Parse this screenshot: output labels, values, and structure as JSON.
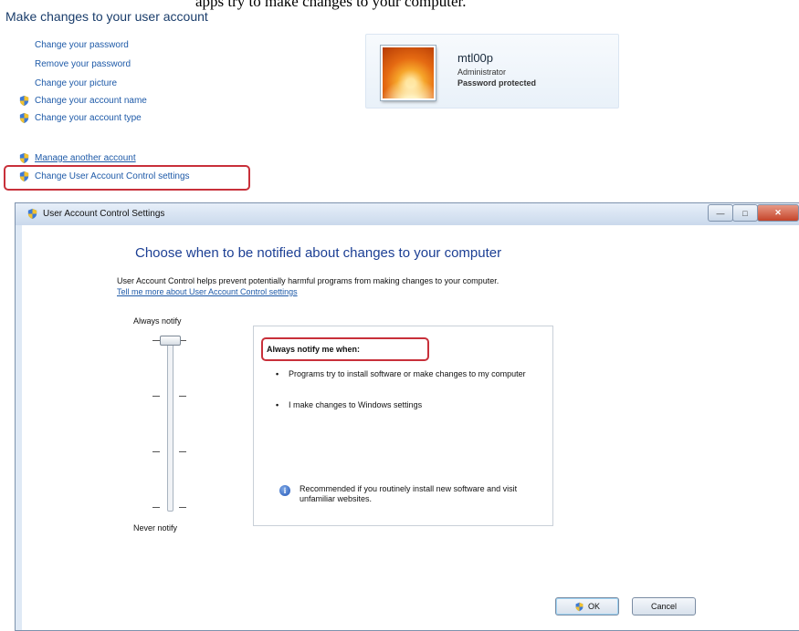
{
  "caption": "apps try to make changes to your computer.",
  "panel_section": {
    "title": "Make changes to your user account",
    "links": [
      {
        "label": "Change your password",
        "shield": false
      },
      {
        "label": "Remove your password",
        "shield": false
      },
      {
        "label": "Change your picture",
        "shield": false
      },
      {
        "label": "Change your account name",
        "shield": true
      },
      {
        "label": "Change your account type",
        "shield": true
      }
    ],
    "other_links": [
      {
        "label": "Manage another account",
        "shield": true
      },
      {
        "label": "Change User Account Control settings",
        "shield": true
      }
    ]
  },
  "account": {
    "name": "mtl00p",
    "role": "Administrator",
    "status": "Password protected"
  },
  "window": {
    "title": "User Account Control Settings",
    "heading": "Choose when to be notified about changes to your computer",
    "description": "User Account Control helps prevent potentially harmful programs from making changes to your computer.",
    "learn_more": "Tell me more about User Account Control settings",
    "slider": {
      "top_label": "Always notify",
      "bottom_label": "Never notify",
      "levels": 4,
      "selected_level": 4
    },
    "notify_panel": {
      "title": "Always notify me when:",
      "bullets": [
        "Programs try to install software or make changes to my computer",
        "I make changes to Windows settings"
      ],
      "recommendation": "Recommended if you routinely install new software and visit unfamiliar websites."
    },
    "buttons": {
      "ok": "OK",
      "cancel": "Cancel"
    }
  },
  "colors": {
    "link": "#1e5aa8",
    "heading": "#1c3f94",
    "highlight": "#c8303a",
    "close_button": "#c5442a"
  },
  "icons": {
    "shield": "uac-shield-icon",
    "info": "info-icon",
    "close": "close-icon"
  }
}
